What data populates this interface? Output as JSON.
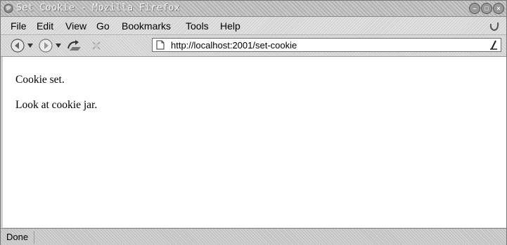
{
  "window": {
    "title": "Set Cookie - Mozilla Firefox"
  },
  "menu": {
    "items": [
      {
        "label": "File"
      },
      {
        "label": "Edit"
      },
      {
        "label": "View"
      },
      {
        "label": "Go"
      },
      {
        "label": "Bookmarks"
      },
      {
        "label": "Tools"
      },
      {
        "label": "Help"
      }
    ]
  },
  "toolbar": {
    "url": "http://localhost:2001/set-cookie",
    "icons": [
      "back-icon",
      "forward-icon",
      "reload-icon",
      "stop-icon",
      "page-icon",
      "go-icon"
    ]
  },
  "content": {
    "line1": "Cookie set.",
    "line2": "Look at cookie jar."
  },
  "status": {
    "text": "Done"
  },
  "colors": {
    "content_bg": "#ffffff",
    "chrome_bg": "#d4d4d4"
  }
}
